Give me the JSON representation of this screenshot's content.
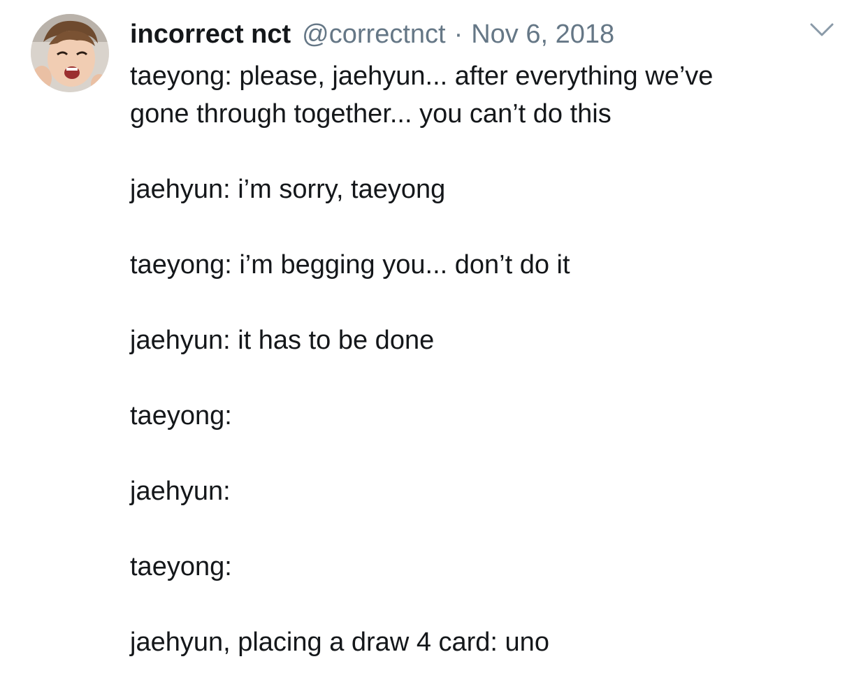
{
  "tweet": {
    "display_name": "incorrect nct",
    "handle": "@correctnct",
    "separator": "·",
    "date": "Nov 6, 2018",
    "menu_icon": "chevron-down-icon",
    "avatar": "avatar",
    "lines": [
      "taeyong: please, jaehyun... after everything we’ve",
      "gone through together... you can’t do this",
      "jaehyun: i’m sorry, taeyong",
      "taeyong: i’m begging you... don’t do it",
      "jaehyun: it has to be done",
      "taeyong:",
      "jaehyun:",
      "taeyong:",
      "jaehyun, placing a draw 4 card: uno"
    ]
  }
}
